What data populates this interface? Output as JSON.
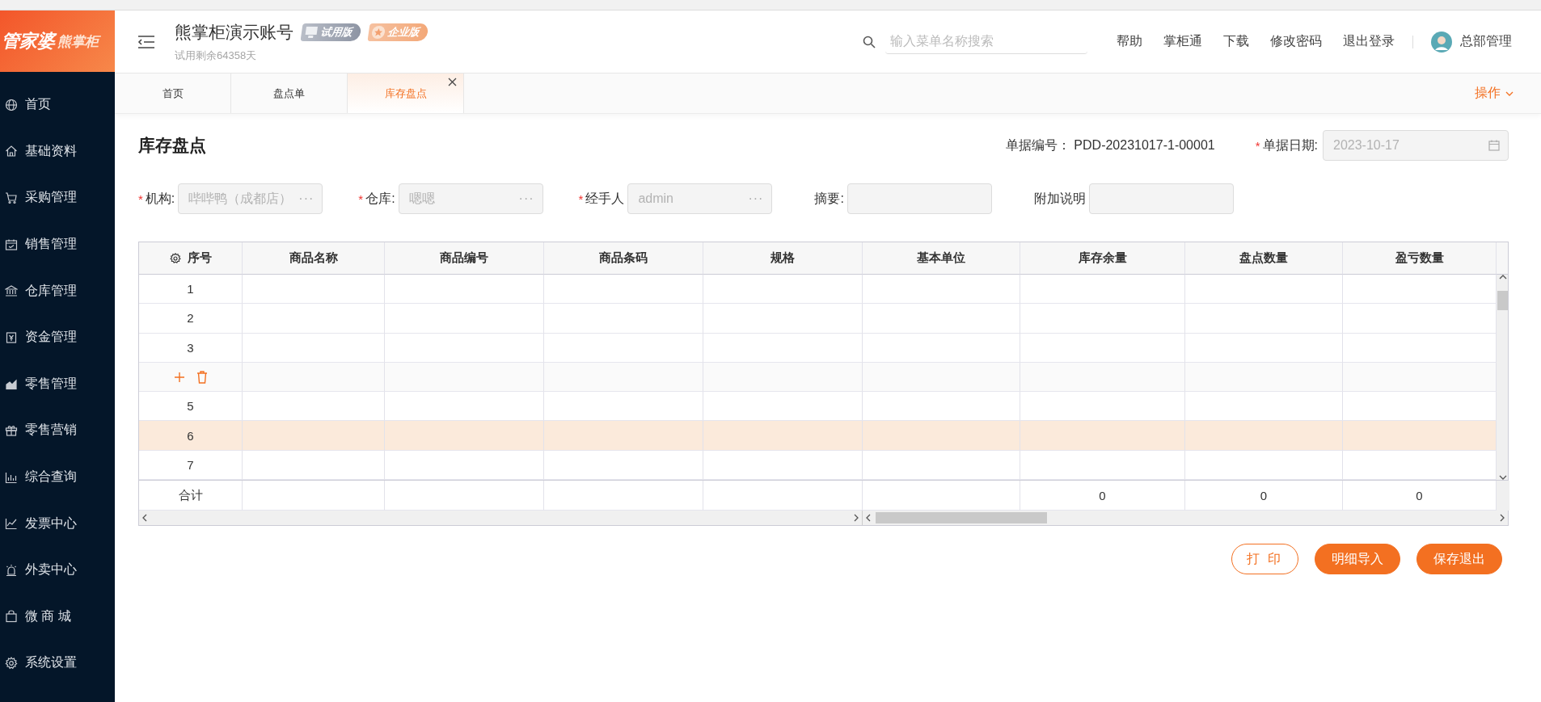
{
  "sidebar": {
    "logo": {
      "brand": "管家婆",
      "product": "熊掌柜"
    },
    "items": [
      {
        "label": "首页"
      },
      {
        "label": "基础资料"
      },
      {
        "label": "采购管理"
      },
      {
        "label": "销售管理"
      },
      {
        "label": "仓库管理"
      },
      {
        "label": "资金管理"
      },
      {
        "label": "零售管理"
      },
      {
        "label": "零售营销"
      },
      {
        "label": "综合查询"
      },
      {
        "label": "发票中心"
      },
      {
        "label": "外卖中心"
      },
      {
        "label": "微 商 城"
      },
      {
        "label": "系统设置"
      }
    ]
  },
  "header": {
    "title": "熊掌柜演示账号",
    "badges": [
      {
        "label": "试用版",
        "kind": "trial"
      },
      {
        "label": "企业版",
        "kind": "enterprise"
      }
    ],
    "trial_text": "试用剩余64358天",
    "search": {
      "placeholder": "输入菜单名称搜索"
    },
    "links": [
      "帮助",
      "掌柜通",
      "下载",
      "修改密码",
      "退出登录"
    ],
    "user": "总部管理"
  },
  "tabs": [
    {
      "label": "首页",
      "selected": false
    },
    {
      "label": "盘点单",
      "selected": false
    },
    {
      "label": "库存盘点",
      "selected": true
    }
  ],
  "tab_actions": "操作",
  "form": {
    "title": "库存盘点",
    "required_mark": "*",
    "doc_number": {
      "label": "单据编号：",
      "value": "PDD-20231017-1-00001"
    },
    "doc_date": {
      "label": "单据日期:",
      "required": true,
      "value": "2023-10-17",
      "disabled": true
    },
    "fields": [
      {
        "label": "机构:",
        "required": true,
        "value": "哔哔鸭（成都店）",
        "picker": "···",
        "disabled": true
      },
      {
        "label": "仓库:",
        "required": true,
        "value": "嗯嗯",
        "picker": "···",
        "disabled": true
      },
      {
        "label": "经手人",
        "required": true,
        "value": "admin",
        "picker": "···",
        "disabled": true
      },
      {
        "label": "摘要:",
        "required": false
      },
      {
        "label": "附加说明",
        "required": false
      }
    ]
  },
  "table": {
    "columns": [
      "序号",
      "商品名称",
      "商品编号",
      "商品条码",
      "规格",
      "基本单位",
      "库存余量",
      "盘点数量",
      "盈亏数量"
    ],
    "rows": [
      {
        "kind": "number",
        "number": "1",
        "selected": false
      },
      {
        "kind": "number",
        "number": "2",
        "selected": false
      },
      {
        "kind": "number",
        "number": "3",
        "selected": false
      },
      {
        "kind": "actions",
        "selected": false
      },
      {
        "kind": "number",
        "number": "5",
        "selected": false
      },
      {
        "kind": "number",
        "number": "6",
        "selected": true
      },
      {
        "kind": "number",
        "number": "7",
        "selected": false
      }
    ],
    "footer": {
      "label": "合计",
      "totals": [
        "0",
        "0",
        "0"
      ]
    }
  },
  "buttons": [
    {
      "label": "打 印",
      "kind": "outline"
    },
    {
      "label": "明细导入",
      "kind": "filled"
    },
    {
      "label": "保存退出",
      "kind": "filled"
    }
  ]
}
